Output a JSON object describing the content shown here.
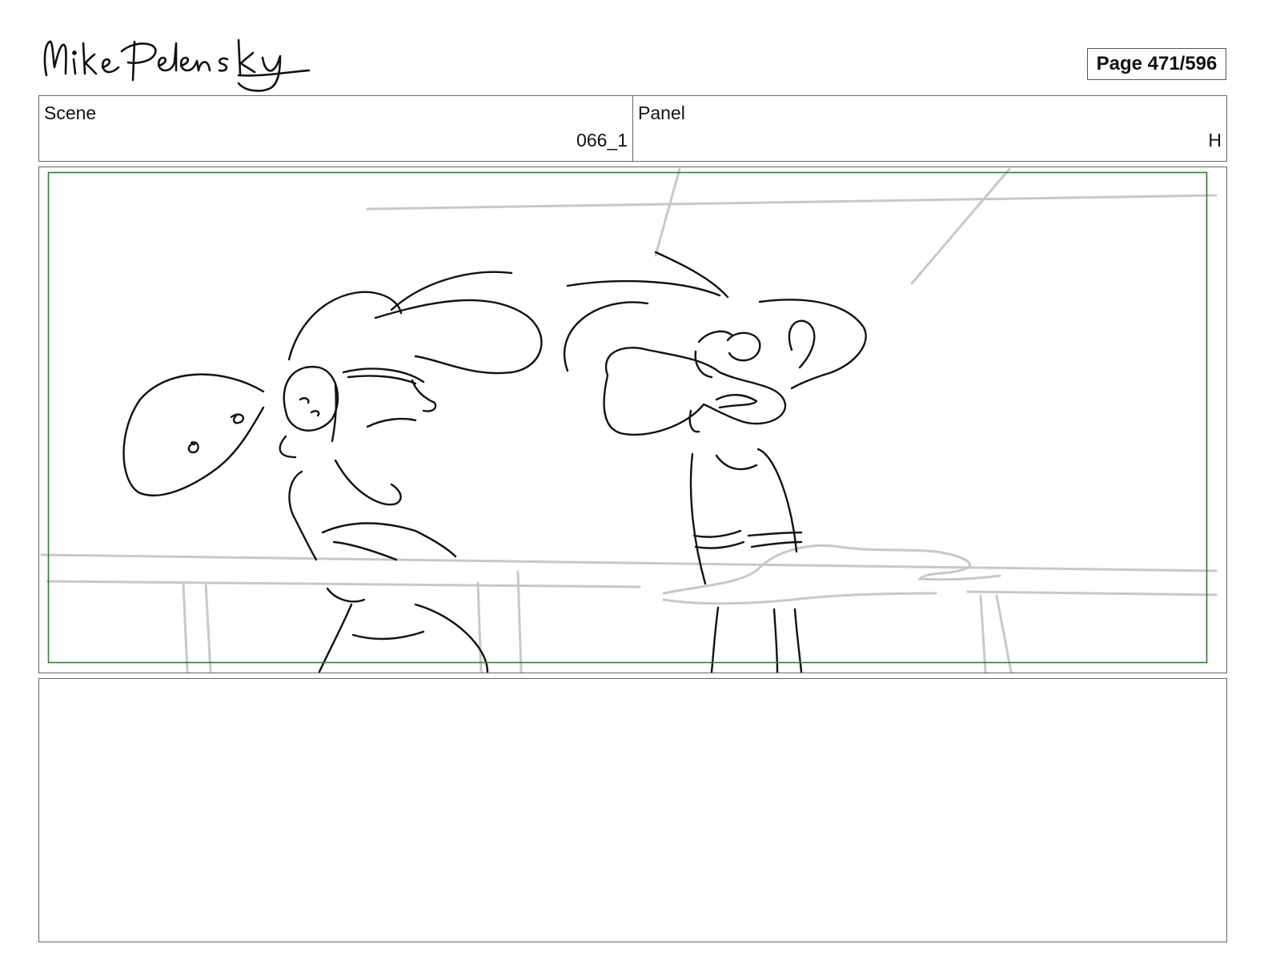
{
  "header": {
    "logo_text": "Mike Pelensky",
    "page_label": "Page 471/596"
  },
  "info": {
    "scene_label": "Scene",
    "scene_value": "066_1",
    "panel_label": "Panel",
    "panel_value": "H"
  },
  "notes": {
    "text": ""
  },
  "colors": {
    "safe_area_border": "#2e7d32",
    "sketch_line": "#111111",
    "background_line": "#c8c8c8"
  }
}
